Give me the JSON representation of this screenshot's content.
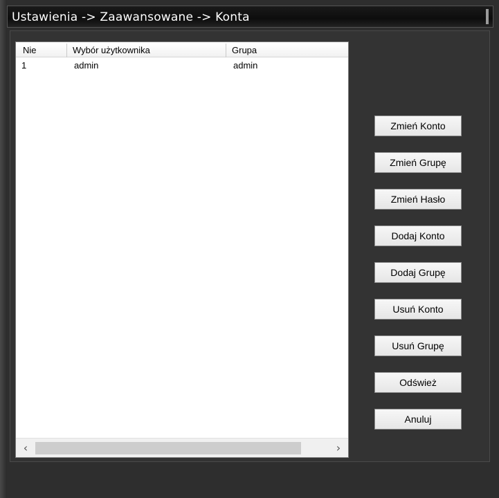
{
  "window": {
    "title": "Ustawienia -> Zaawansowane -> Konta"
  },
  "table": {
    "columns": [
      "Nie",
      "Wybór użytkownika",
      "Grupa"
    ],
    "rows": [
      {
        "nie": "1",
        "user": "admin",
        "group": "admin"
      }
    ]
  },
  "scrollbar": {
    "left_arrow": "‹",
    "right_arrow": "›"
  },
  "buttons": {
    "change_account": "Zmień Konto",
    "change_group": "Zmień Grupę",
    "change_password": "Zmień Hasło",
    "add_account": "Dodaj Konto",
    "add_group": "Dodaj Grupę",
    "delete_account": "Usuń Konto",
    "delete_group": "Usuń Grupę",
    "refresh": "Odśwież",
    "cancel": "Anuluj"
  }
}
